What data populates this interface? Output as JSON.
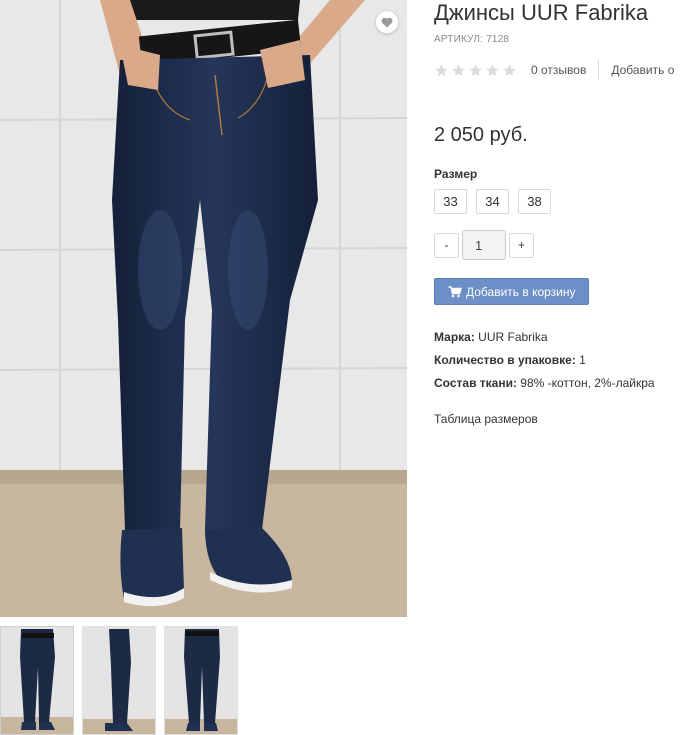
{
  "product": {
    "title": "Джинсы UUR Fabrika",
    "article": "АРТИКУЛ: 7128",
    "reviews_count": "0 отзывов",
    "add_review": "Добавить о",
    "price": "2 050 руб.",
    "rating": 0,
    "rating_max": 5
  },
  "sizes": {
    "label": "Размер",
    "options": [
      "33",
      "34",
      "38"
    ]
  },
  "quantity": {
    "minus": "-",
    "value": "1",
    "plus": "+"
  },
  "cart": {
    "label": "Добавить в корзину"
  },
  "specs": [
    {
      "key": "Марка:",
      "value": " UUR Fabrika"
    },
    {
      "key": "Количество в упаковке:",
      "value": " 1"
    },
    {
      "key": "Состав ткани:",
      "value": " 98% -коттон, 2%-лайкра"
    }
  ],
  "size_table_link": "Таблица размеров",
  "colors": {
    "accent_button": "#6b8fc6",
    "star_empty": "#dcdcdc",
    "denim": "#1d2a45"
  },
  "icons": {
    "wishlist": "heart-icon",
    "cart": "cart-icon",
    "star": "star-icon"
  }
}
